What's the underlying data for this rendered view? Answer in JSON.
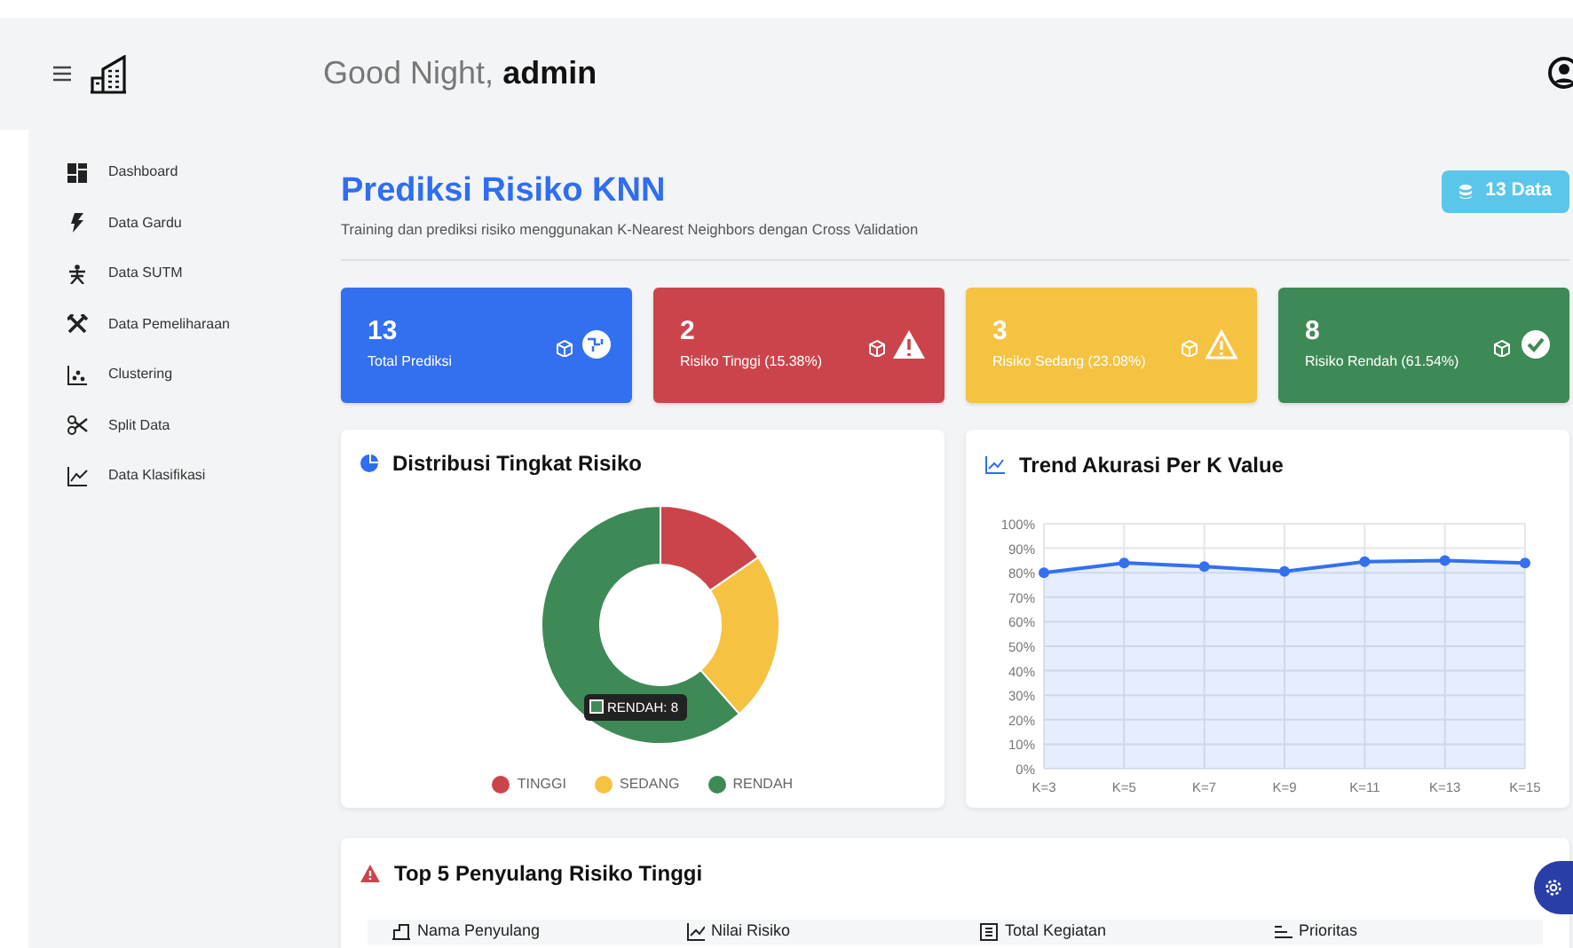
{
  "header": {
    "greeting": "Good Night,",
    "user": "admin"
  },
  "sidebar": {
    "items": [
      {
        "label": "Dashboard"
      },
      {
        "label": "Data Gardu"
      },
      {
        "label": "Data SUTM"
      },
      {
        "label": "Data Pemeliharaan"
      },
      {
        "label": "Clustering"
      },
      {
        "label": "Split Data"
      },
      {
        "label": "Data Klasifikasi"
      }
    ]
  },
  "page": {
    "title": "Prediksi Risiko KNN",
    "subtitle": "Training dan prediksi risiko menggunakan K-Nearest Neighbors dengan Cross Validation",
    "badge": "13 Data"
  },
  "stats": [
    {
      "kind": "total",
      "value": "13",
      "label": "Total Prediksi"
    },
    {
      "kind": "high",
      "value": "2",
      "label": "Risiko Tinggi (15.38%)"
    },
    {
      "kind": "medium",
      "value": "3",
      "label": "Risiko Sedang (23.08%)"
    },
    {
      "kind": "low",
      "value": "8",
      "label": "Risiko Rendah (61.54%)"
    }
  ],
  "distribution": {
    "title": "Distribusi Tingkat Risiko",
    "tooltip": "RENDAH: 8",
    "chart_data": {
      "type": "donut",
      "categories": [
        "TINGGI",
        "SEDANG",
        "RENDAH"
      ],
      "series": [
        {
          "values": [
            15.38,
            23.08,
            61.54
          ]
        }
      ],
      "colors": [
        "#cc444b",
        "#f5c242",
        "#3e8a56"
      ]
    }
  },
  "trend": {
    "title": "Trend Akurasi Per K Value",
    "chart_data": {
      "type": "area",
      "categories": [
        "K=3",
        "K=5",
        "K=7",
        "K=9",
        "K=11",
        "K=13",
        "K=15"
      ],
      "grid": true,
      "series": [
        {
          "color": "#3370f0",
          "values": [
            80,
            84,
            82.5,
            80.5,
            84.5,
            85,
            84
          ]
        }
      ],
      "ylim": [
        0,
        100
      ],
      "yticks": [
        {
          "value": 0,
          "label": "0%"
        },
        {
          "value": 10,
          "label": "10%"
        },
        {
          "value": 20,
          "label": "20%"
        },
        {
          "value": 30,
          "label": "30%"
        },
        {
          "value": 40,
          "label": "40%"
        },
        {
          "value": 50,
          "label": "50%"
        },
        {
          "value": 60,
          "label": "60%"
        },
        {
          "value": 70,
          "label": "70%"
        },
        {
          "value": 80,
          "label": "80%"
        },
        {
          "value": 90,
          "label": "90%"
        },
        {
          "value": 100,
          "label": "100%"
        }
      ]
    }
  },
  "top_feeders": {
    "title": "Top 5 Penyulang Risiko Tinggi",
    "columns": [
      "Nama Penyulang",
      "Nilai Risiko",
      "Total Kegiatan",
      "Prioritas"
    ]
  }
}
